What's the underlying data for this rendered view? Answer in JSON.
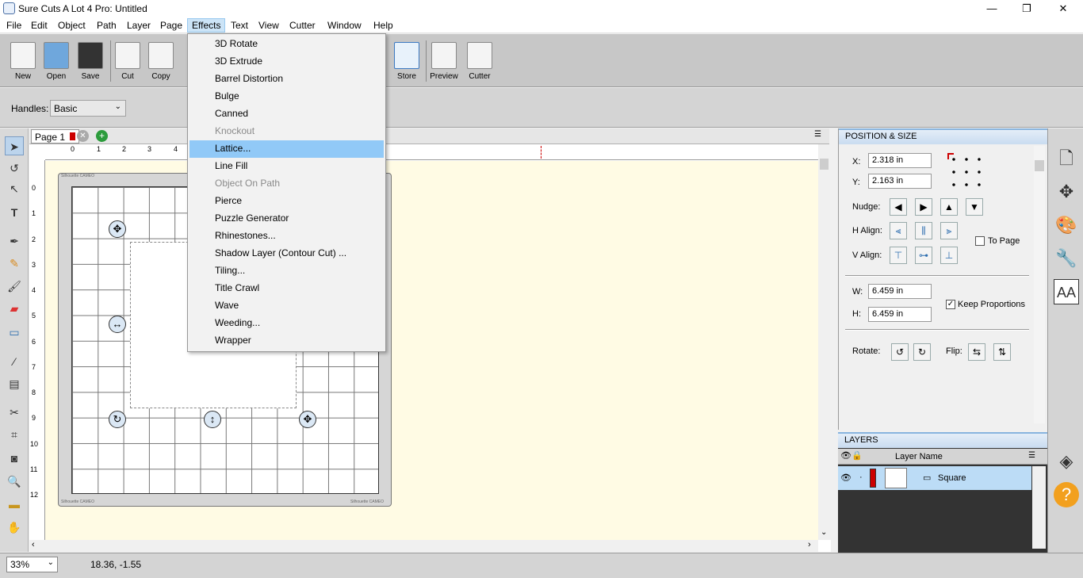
{
  "window": {
    "title": "Sure Cuts A Lot 4 Pro: Untitled",
    "minimize": "—",
    "maximize": "❐",
    "close": "✕"
  },
  "menu": [
    "File",
    "Edit",
    "Object",
    "Path",
    "Layer",
    "Page",
    "Effects",
    "Text",
    "View",
    "Cutter",
    "Window",
    "Help"
  ],
  "toolbar": {
    "new": "New",
    "open": "Open",
    "save": "Save",
    "cut": "Cut",
    "copy": "Copy",
    "store": "Store",
    "preview": "Preview",
    "cutter": "Cutter"
  },
  "handles": {
    "label": "Handles:",
    "value": "Basic"
  },
  "page_tab": {
    "label": "Page 1"
  },
  "ruler": {
    "top": [
      "0",
      "1",
      "2",
      "3",
      "4"
    ],
    "left": [
      "0",
      "1",
      "2",
      "3",
      "4",
      "5",
      "6",
      "7",
      "8",
      "9",
      "10",
      "11",
      "12"
    ]
  },
  "mat": {
    "brand_tl": "Silhouette CAMEO",
    "brand_bl": "Silhouette CAMEO",
    "brand_br": "Silhouette CAMEO"
  },
  "effects_menu": [
    {
      "label": "3D Rotate",
      "enabled": true
    },
    {
      "label": "3D Extrude",
      "enabled": true
    },
    {
      "label": "Barrel Distortion",
      "enabled": true
    },
    {
      "label": "Bulge",
      "enabled": true
    },
    {
      "label": "Canned",
      "enabled": true
    },
    {
      "label": "Knockout",
      "enabled": false
    },
    {
      "label": "Lattice...",
      "enabled": true,
      "highlighted": true
    },
    {
      "label": "Line Fill",
      "enabled": true
    },
    {
      "label": "Object On Path",
      "enabled": false
    },
    {
      "label": "Pierce",
      "enabled": true
    },
    {
      "label": "Puzzle Generator",
      "enabled": true
    },
    {
      "label": "Rhinestones...",
      "enabled": true
    },
    {
      "label": "Shadow Layer (Contour Cut) ...",
      "enabled": true
    },
    {
      "label": "Tiling...",
      "enabled": true
    },
    {
      "label": "Title Crawl",
      "enabled": true
    },
    {
      "label": "Wave",
      "enabled": true
    },
    {
      "label": "Weeding...",
      "enabled": true
    },
    {
      "label": "Wrapper",
      "enabled": true
    }
  ],
  "position_size": {
    "header": "POSITION & SIZE",
    "x_label": "X:",
    "x_value": "2.318 in",
    "y_label": "Y:",
    "y_value": "2.163 in",
    "nudge_label": "Nudge:",
    "h_align_label": "H Align:",
    "v_align_label": "V Align:",
    "to_page_label": "To Page",
    "w_label": "W:",
    "w_value": "6.459 in",
    "h_label": "H:",
    "h_value": "6.459 in",
    "keep_proportions_label": "Keep Proportions",
    "keep_proportions_checked": true,
    "rotate_label": "Rotate:",
    "flip_label": "Flip:"
  },
  "layers": {
    "header": "LAYERS",
    "column_name": "Layer Name",
    "rows": [
      {
        "name": "Square"
      }
    ]
  },
  "status": {
    "zoom": "33%",
    "coords": "18.36, -1.55"
  },
  "colors": {
    "accent": "#91c9f7",
    "workspace": "#fffbe4",
    "layer_color": "#cc0000"
  }
}
